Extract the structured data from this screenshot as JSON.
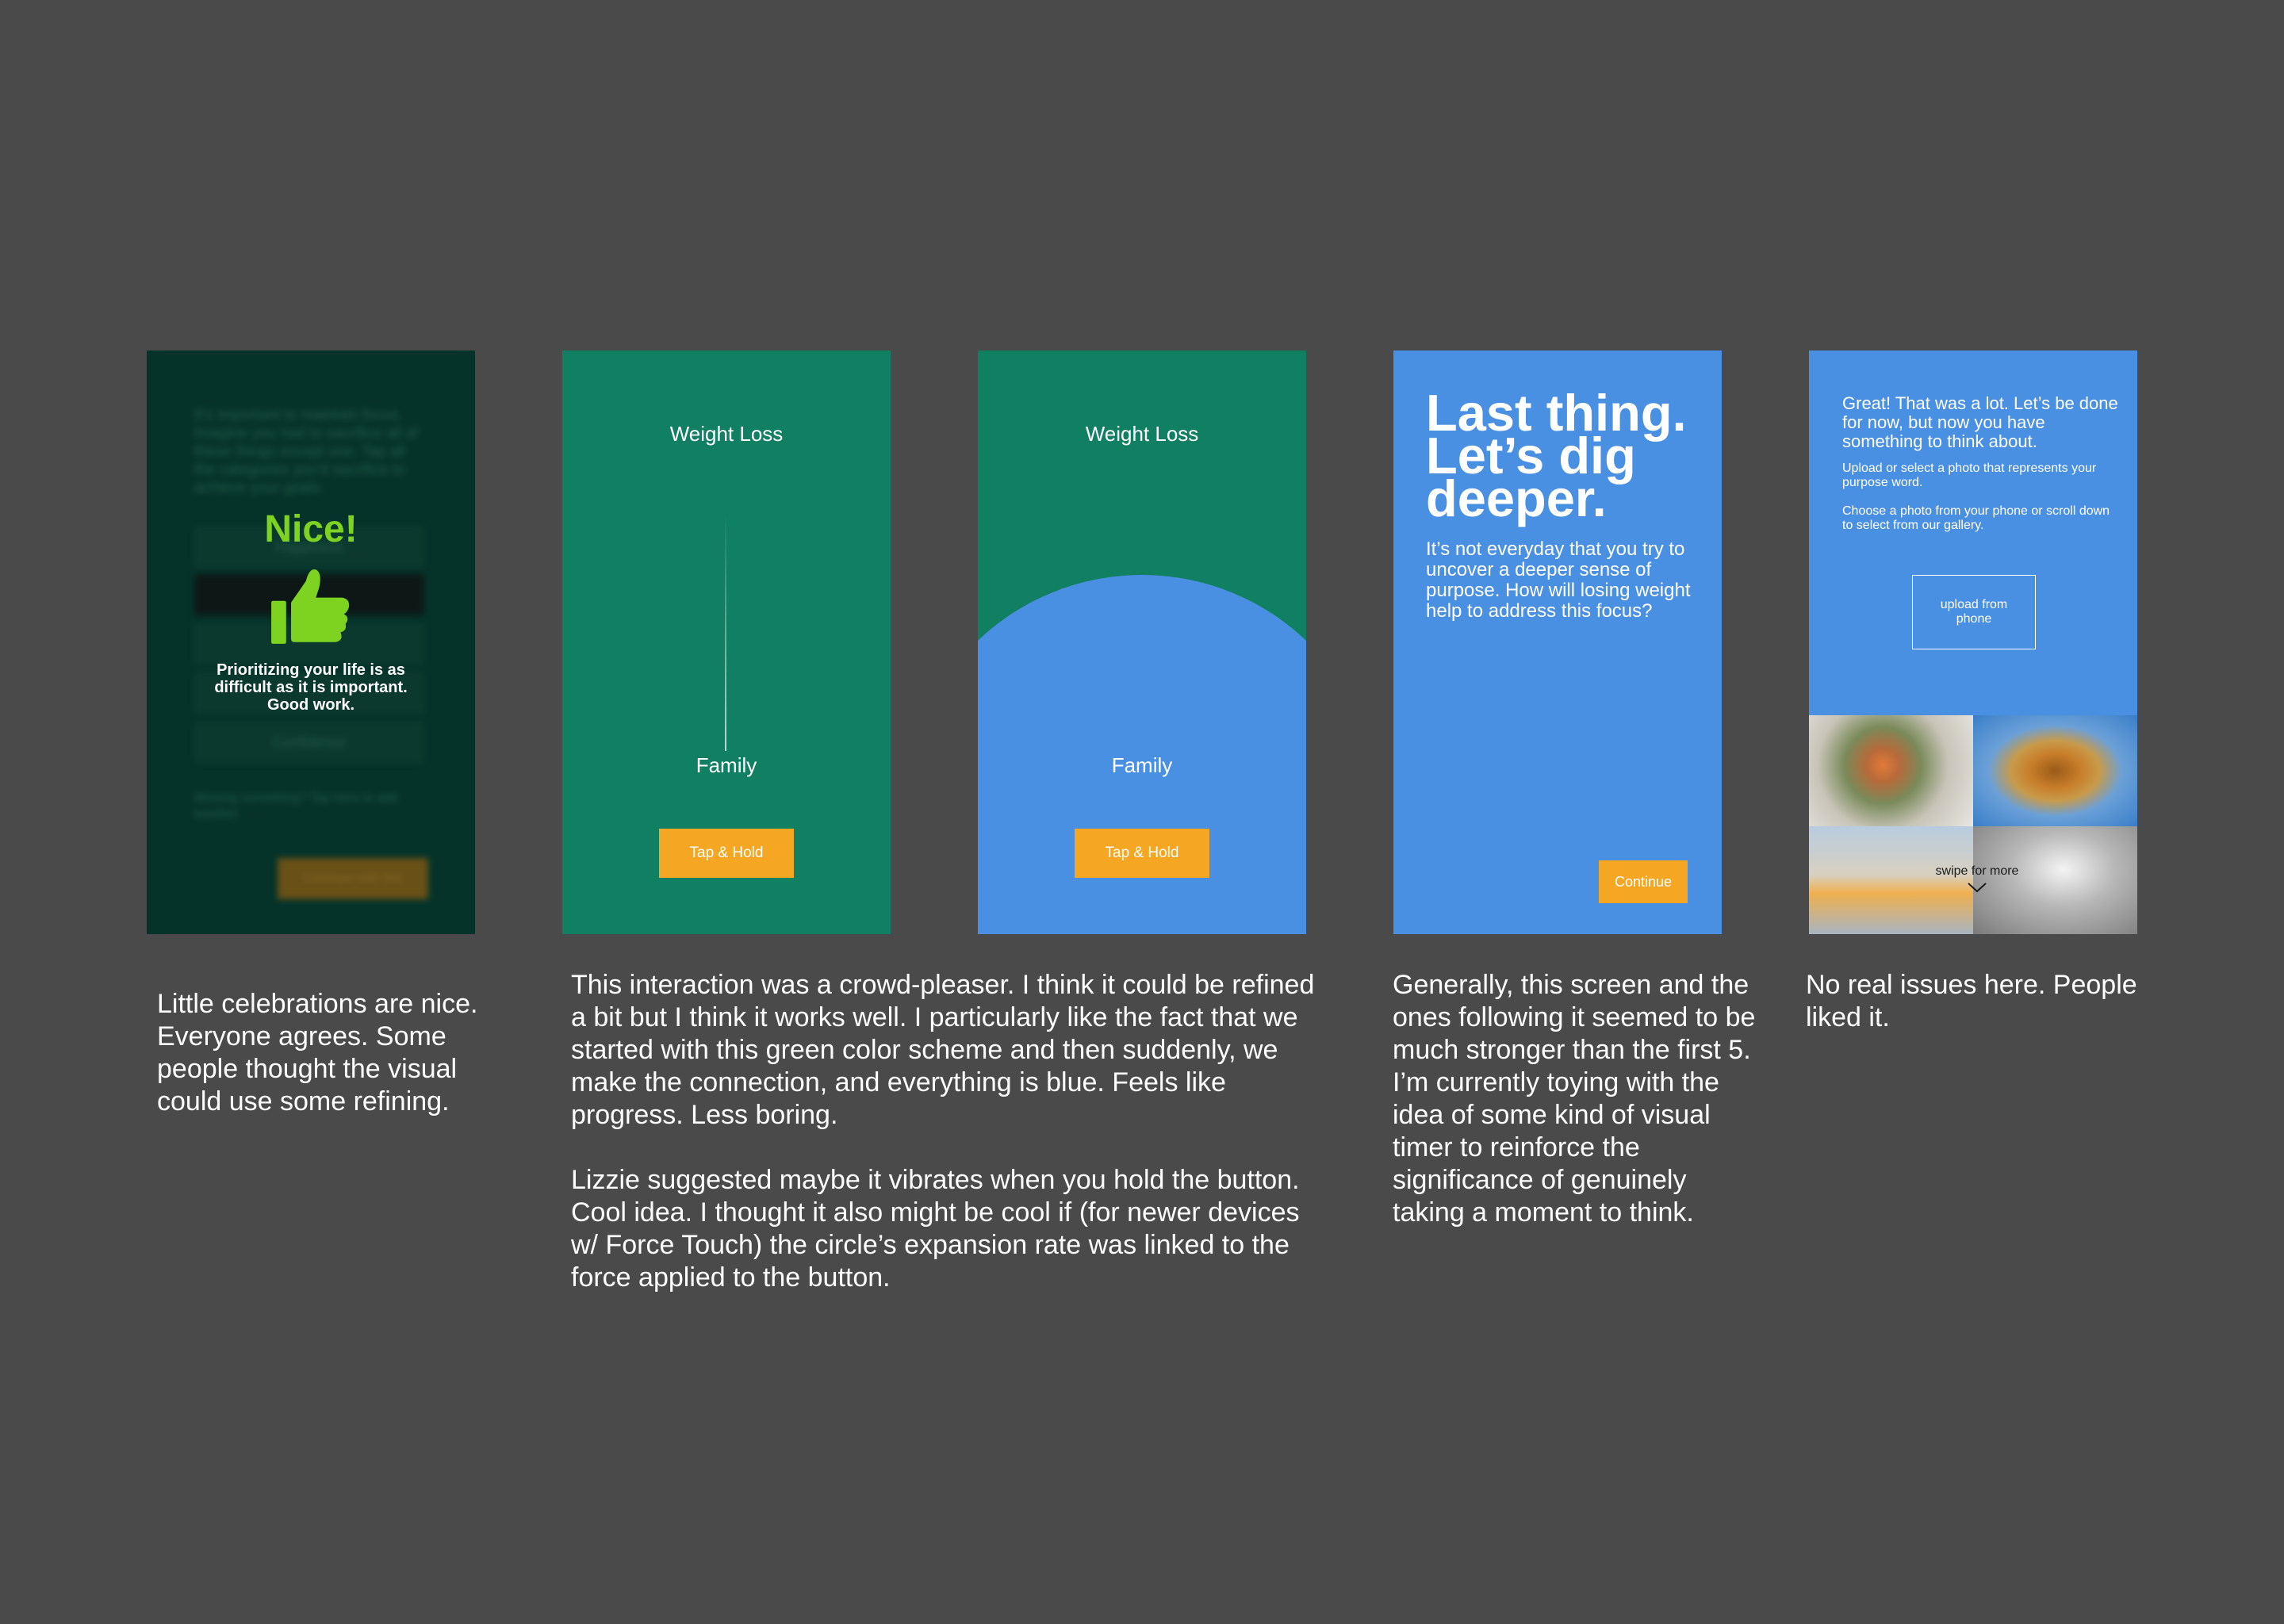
{
  "screens": {
    "celebration": {
      "background_text": "It's important to maintain focus. Imagine you had to sacrifice all of these things except one. Tap all the categories you'd sacrifice to achieve your goals.",
      "background_rows": [
        "Happiness",
        "",
        "Confidence"
      ],
      "background_footer": "Missing something? Tap here to add another.",
      "background_button": "Continue with this",
      "title": "Nice!",
      "icon": "thumbs-up-icon",
      "message": "Prioritizing your life is as difficult as it is important. Good work."
    },
    "connect_idle": {
      "top_label": "Weight Loss",
      "bottom_label": "Family",
      "button_label": "Tap & Hold"
    },
    "connect_active": {
      "top_label": "Weight Loss",
      "bottom_label": "Family",
      "button_label": "Tap & Hold"
    },
    "dig_deeper": {
      "title": "Last thing. Let’s dig deeper.",
      "body": "It’s not everyday that you try to uncover a deeper sense of purpose. How will losing weight help to address this focus?",
      "button_label": "Continue"
    },
    "photo_pick": {
      "heading": "Great! That was a lot. Let’s be done for now, but now you have something to think about.",
      "sub1": "Upload or select a photo that represents your purpose word.",
      "sub2": "Choose a photo from your phone or scroll down to select from our gallery.",
      "upload_label": "upload from phone",
      "swipe_label": "swipe for more",
      "chevron_icon": "chevron-down-icon"
    }
  },
  "captions": {
    "c1": "Little celebrations are nice. Everyone agrees. Some people thought the visual could use some refining.",
    "c2a": "This interaction was a crowd-pleaser. I think it could be refined a bit but I think it works well. I particularly like the fact that we started with this green color scheme and then suddenly, we make the connection, and everything is blue. Feels like progress. Less boring.",
    "c2b": "Lizzie suggested maybe it vibrates when you hold the button. Cool idea. I thought it also might be cool if (for newer devices w/ Force Touch) the circle’s expansion rate was linked to the force applied to the button.",
    "c3": "Generally, this screen and the ones following it seemed to be much stronger than the first 5.  I’m currently toying with the idea of some kind of visual timer to reinforce the significance of genuinely taking a moment to think.",
    "c4": "No real issues here. People liked it."
  },
  "colors": {
    "page_bg": "#4a4a4a",
    "dark_green": "#05332a",
    "green": "#117f61",
    "blue": "#4a90e2",
    "orange": "#f5a623",
    "lime": "#7ed321"
  }
}
